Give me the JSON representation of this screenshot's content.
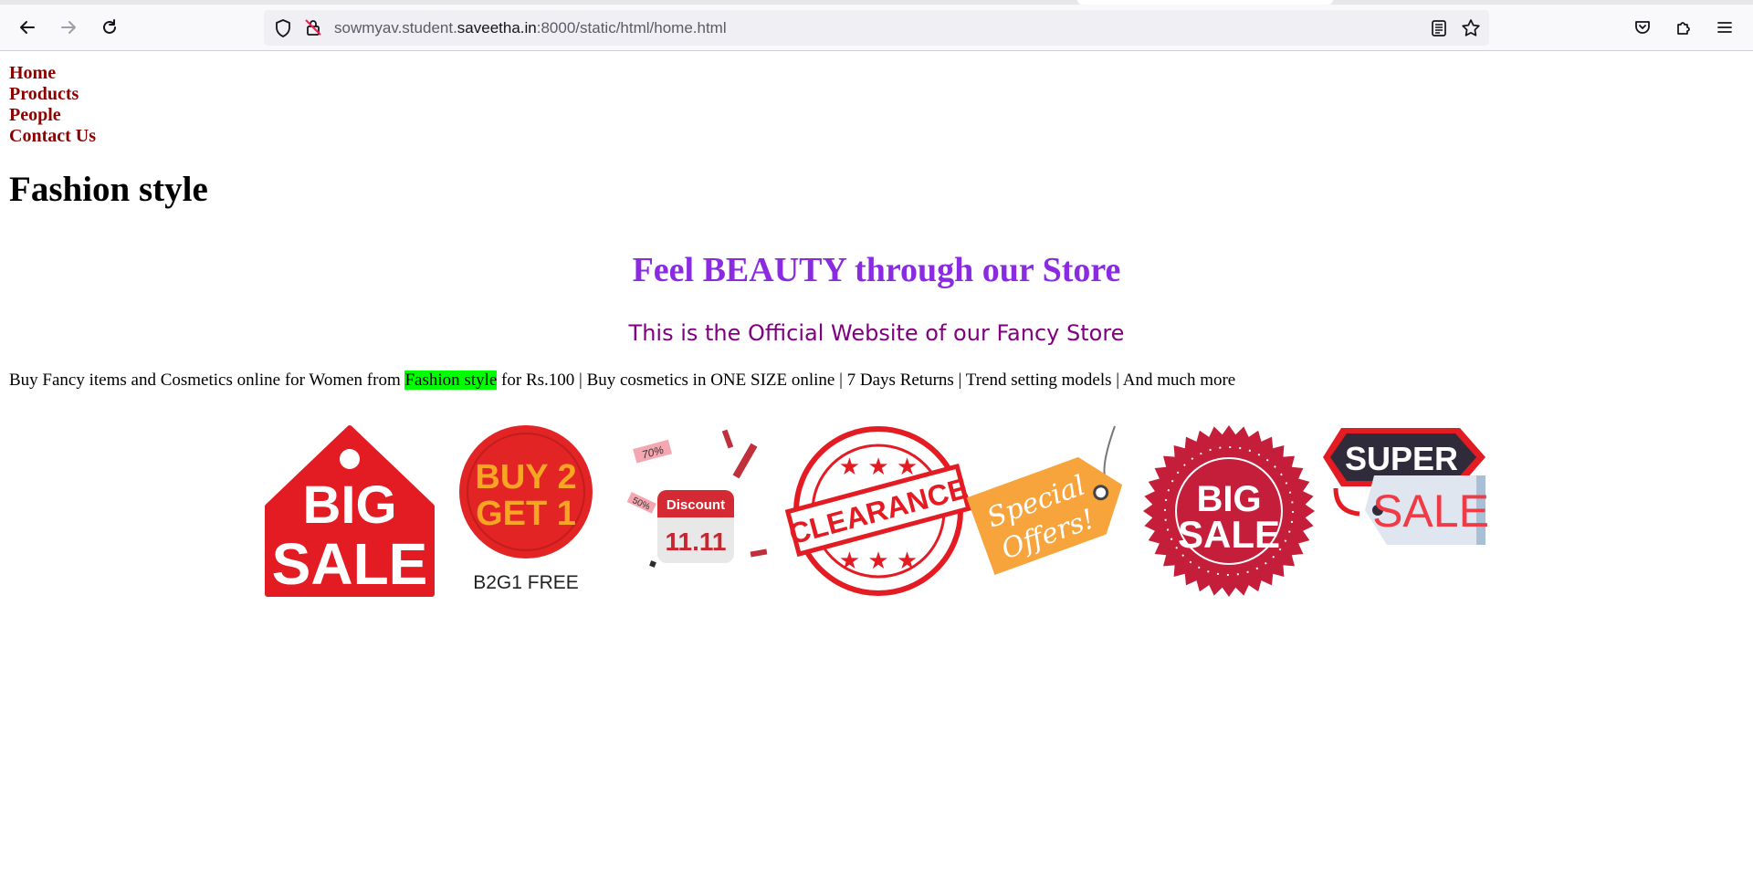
{
  "browser": {
    "url_prefix": "sowmyav.student.",
    "url_domain": "saveetha.in",
    "url_suffix": ":8000/static/html/home.html",
    "icons": [
      "back-arrow-icon",
      "forward-arrow-icon",
      "reload-icon",
      "shield-icon",
      "insecure-lock-icon",
      "reader-view-icon",
      "bookmark-star-icon",
      "pocket-icon",
      "extensions-icon",
      "menu-icon"
    ]
  },
  "nav": {
    "items": [
      {
        "label": "Home"
      },
      {
        "label": "Products"
      },
      {
        "label": "People"
      },
      {
        "label": "Contact Us"
      }
    ]
  },
  "page": {
    "title": "Fashion style",
    "tagline": "Feel BEAUTY through our Store",
    "subtagline": "This is the Official Website of our Fancy Store",
    "description_before": "Buy Fancy items and Cosmetics online for Women from ",
    "description_highlight": "Fashion style",
    "description_after": " for Rs.100 | Buy cosmetics in ONE SIZE online | 7 Days Returns | Trend setting models | And much more"
  },
  "badges": {
    "big_sale_1": {
      "line1": "BIG",
      "line2": "SALE"
    },
    "buy2get1": {
      "line1": "BUY 2",
      "line2": "GET 1",
      "caption": "B2G1 FREE"
    },
    "discount": {
      "label": "Discount",
      "date": "11.11",
      "pct1": "70%",
      "pct2": "50%"
    },
    "clearance": {
      "label": "CLEARANCE"
    },
    "special_offers": {
      "line1": "Special",
      "line2": "Offers!"
    },
    "big_sale_2": {
      "line1": "BIG",
      "line2": "SALE"
    },
    "super_sale": {
      "line1": "SUPER",
      "line2": "SALE"
    }
  },
  "colors": {
    "nav_link": "#8b0000",
    "tagline": "#8a2be2",
    "subtagline": "#800080",
    "highlight": "#00ff00",
    "sale_red": "#e31b23"
  }
}
